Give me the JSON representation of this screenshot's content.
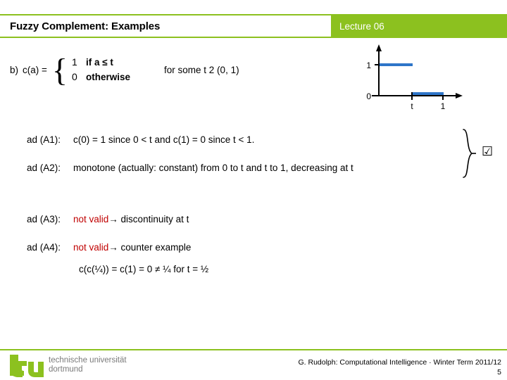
{
  "header": {
    "title": "Fuzzy Complement: Examples",
    "lecture": "Lecture 06",
    "band_color": "#8cc11f"
  },
  "definition": {
    "item_label": "b)",
    "lhs": "c(a) =",
    "brace": "{",
    "cases": [
      {
        "value": "1",
        "condition": "if a ≤ t"
      },
      {
        "value": "0",
        "condition": "otherwise"
      }
    ],
    "suffix": "for some t 2 (0, 1)"
  },
  "chart_data": {
    "type": "line",
    "title": "",
    "xlabel": "",
    "ylabel": "",
    "xlim": [
      0,
      1.25
    ],
    "ylim": [
      0,
      1.25
    ],
    "grid": false,
    "legend": null,
    "xticks": [
      {
        "value": 0.45,
        "label": "t"
      },
      {
        "value": 0.9,
        "label": "1"
      }
    ],
    "yticks": [
      {
        "value": 0,
        "label": "0"
      },
      {
        "value": 1,
        "label": "1"
      }
    ],
    "series": [
      {
        "name": "c(a) = 1 for a ≤ t",
        "color": "#2e75c8",
        "x": [
          0,
          0.45
        ],
        "y": [
          1,
          1
        ]
      },
      {
        "name": "c(a) = 0 for a > t",
        "color": "#2e75c8",
        "x": [
          0.45,
          0.9
        ],
        "y": [
          0,
          0
        ]
      }
    ]
  },
  "axioms": [
    {
      "key": "ad (A1):",
      "text": "c(0) = 1 since 0 < t   and  c(1) = 0 since t < 1.",
      "invalid": false
    },
    {
      "key": "ad (A2):",
      "text": "monotone (actually: constant) from 0 to t and t to 1, decreasing at t",
      "invalid": false
    },
    {
      "key": "ad (A3):",
      "invalid_label": "not valid",
      "text": " → discontinuity at t",
      "invalid": true
    },
    {
      "key": "ad (A4):",
      "invalid_label": "not valid",
      "text": " → counter example",
      "invalid": true
    }
  ],
  "group_marker": {
    "check_glyph": "☑"
  },
  "counter_example": {
    "formula": "c(c(¼)) = c(1) = 0  ≠  ¼  for t = ½"
  },
  "footer": {
    "logo_mark": "tu",
    "logo_line1": "technische universität",
    "logo_line2": "dortmund",
    "credit": "G. Rudolph: Computational Intelligence · Winter Term 2011/12",
    "page_number": "5",
    "rule_color": "#8cc11f",
    "logo_color": "#8cc11f"
  }
}
